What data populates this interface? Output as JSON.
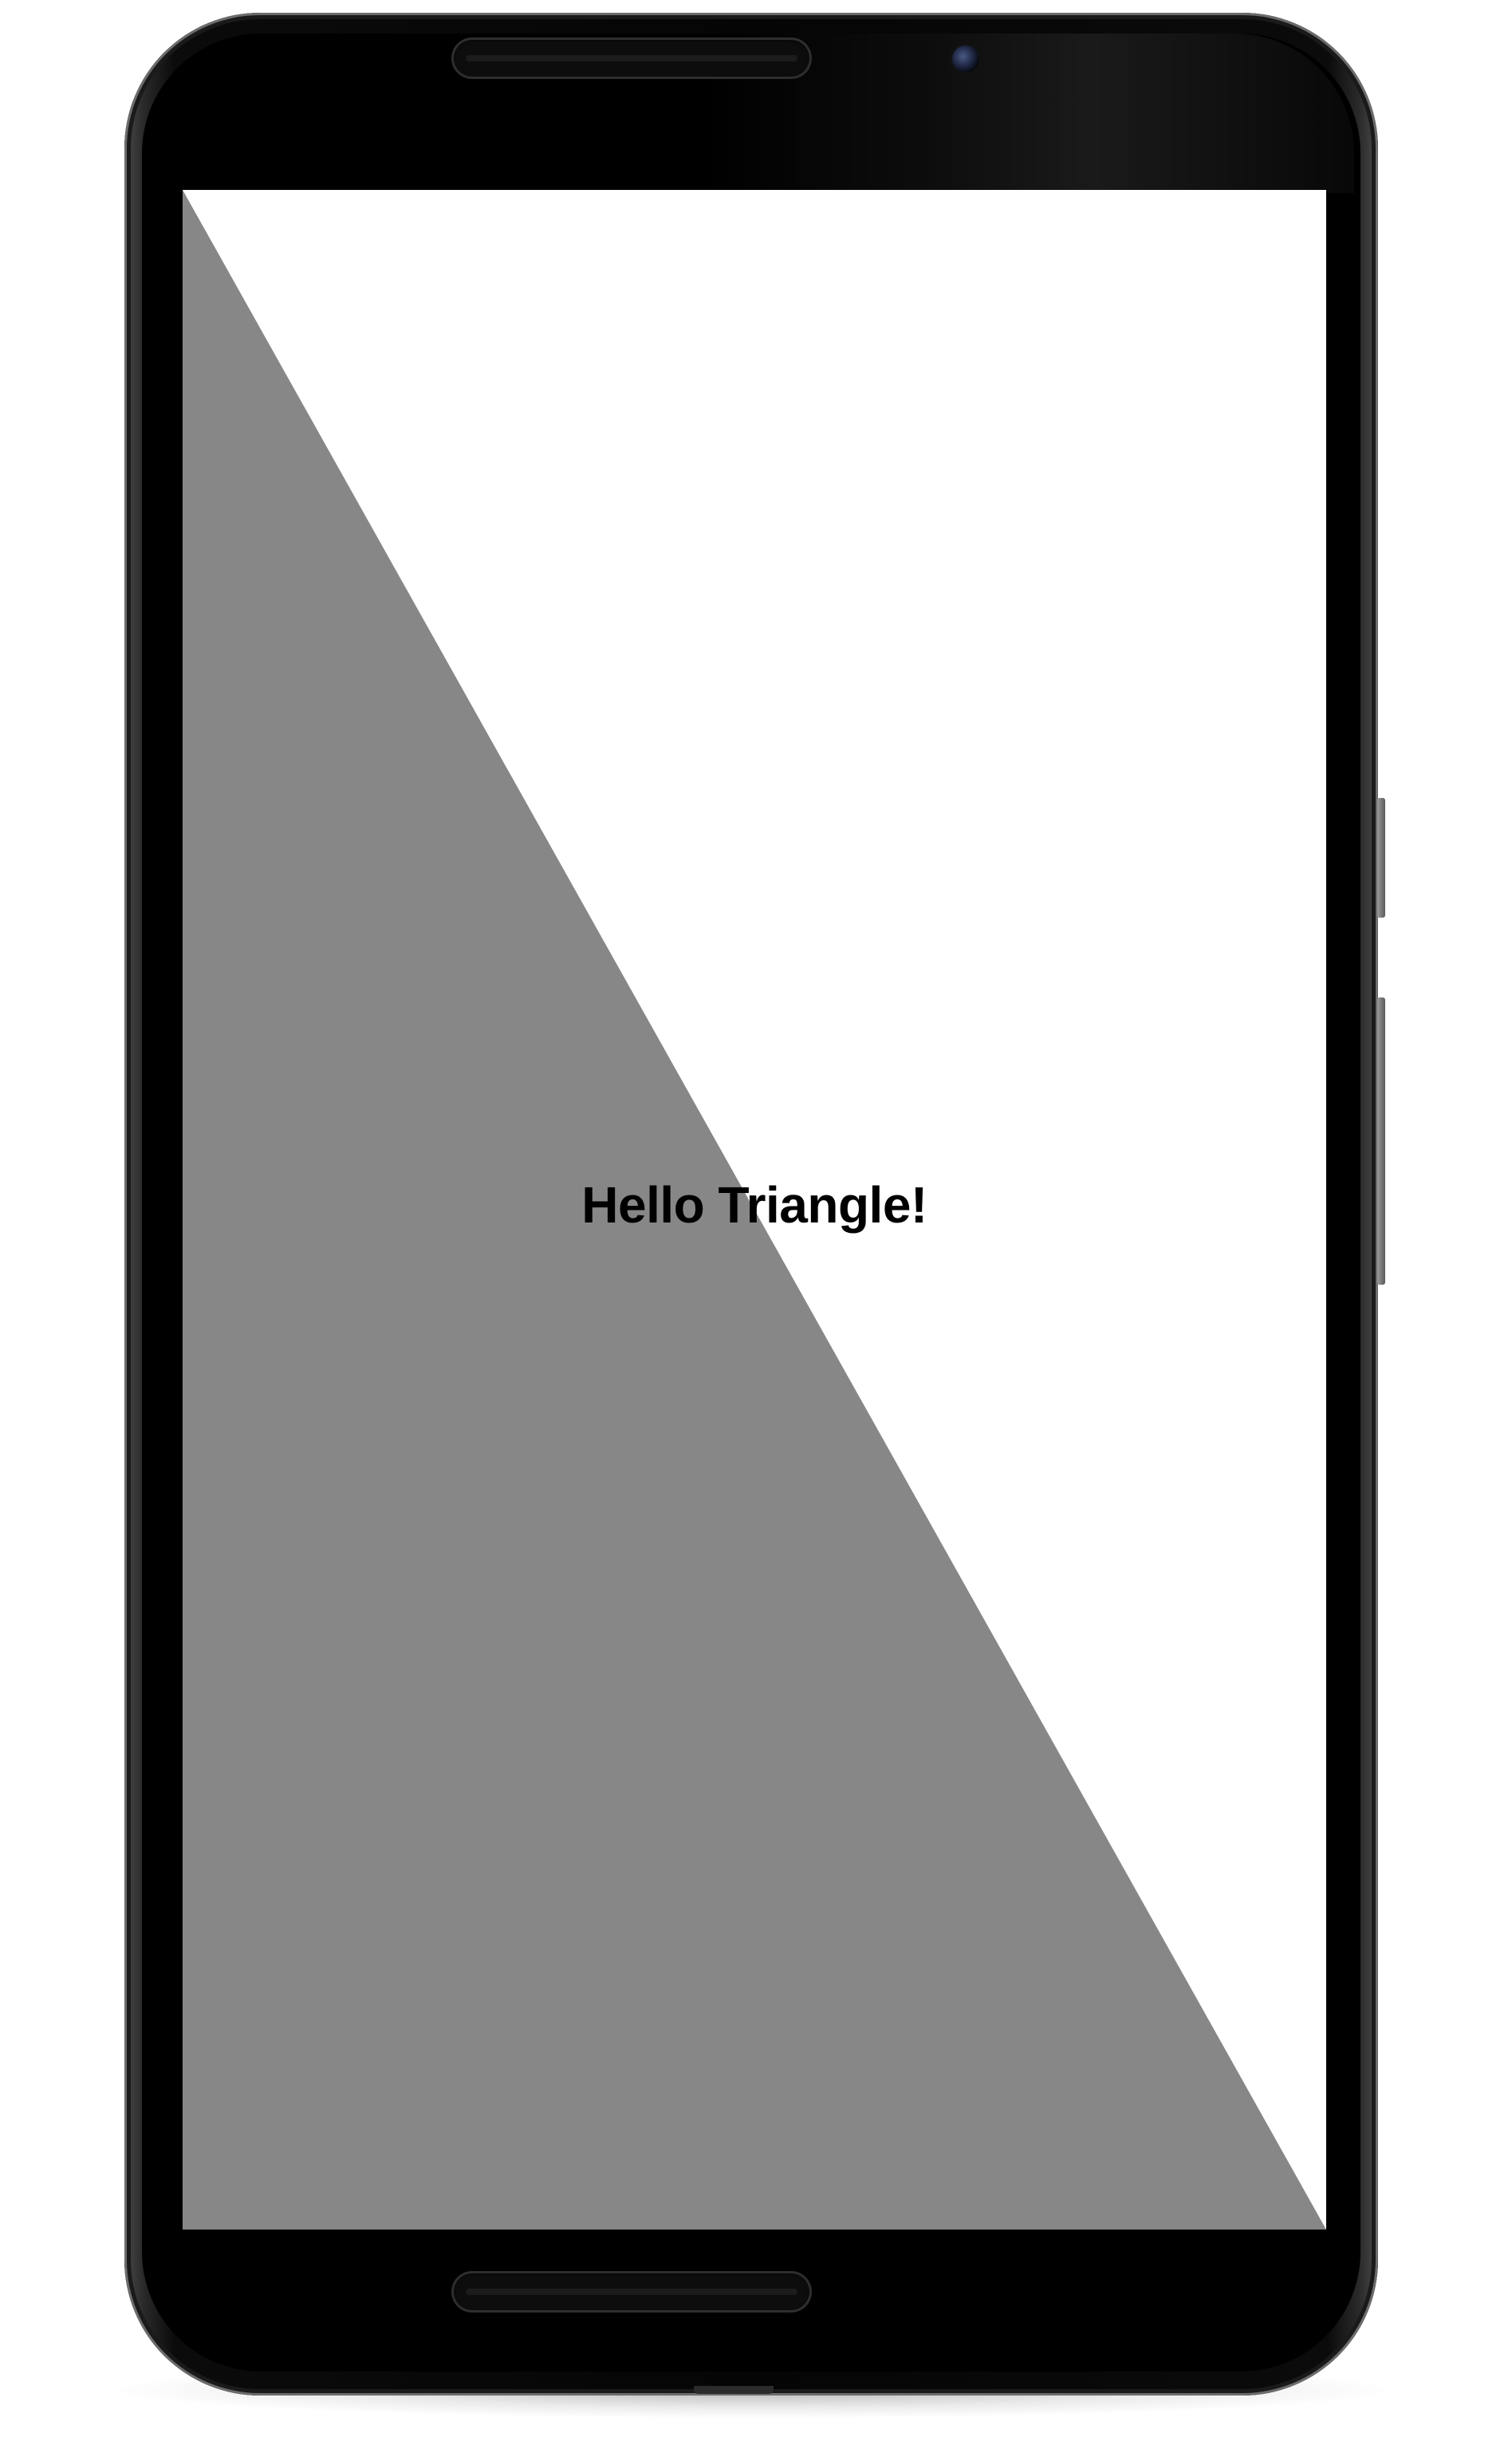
{
  "app": {
    "message": "Hello Triangle!"
  },
  "colors": {
    "screen_background": "#ffffff",
    "triangle_fill": "#878787",
    "text": "#000000",
    "device_body": "#050505"
  },
  "icons": {
    "camera": "front-camera-icon",
    "speaker": "speaker-grille"
  }
}
